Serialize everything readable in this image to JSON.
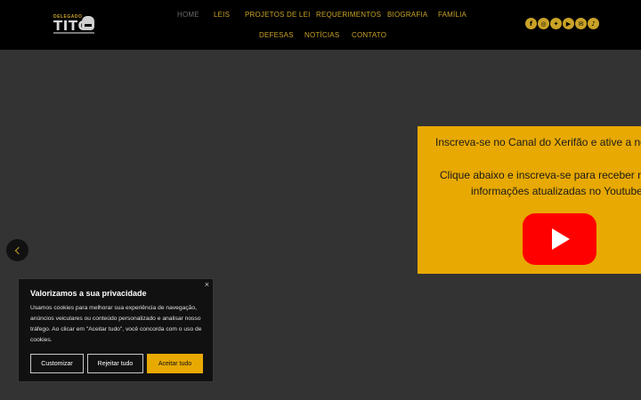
{
  "nav": {
    "items": [
      {
        "label": "HOME",
        "active": true
      },
      {
        "label": "LEIS"
      },
      {
        "label": "PROJETOS DE LEI"
      },
      {
        "label": "REQUERIMENTOS"
      },
      {
        "label": "BIOGRAFIA"
      },
      {
        "label": "FAMÍLIA"
      },
      {
        "label": "DEFESAS"
      },
      {
        "label": "NOTÍCIAS"
      },
      {
        "label": "CONTATO"
      }
    ]
  },
  "logo": {
    "top_text": "DELEGADO",
    "main_text": "TITO"
  },
  "socials": {
    "icons": [
      "facebook-icon",
      "instagram-icon",
      "twitter-icon",
      "youtube-icon",
      "email-icon",
      "tiktok-icon"
    ]
  },
  "promo": {
    "line1": "Inscreva-se no Canal do Xerifão e ative a no",
    "line2": "Clique abaixo e inscreva-se para receber no",
    "line3": "informações atualizadas no Youtube"
  },
  "cookie": {
    "close": "×",
    "title": "Valorizamos a sua privacidade",
    "text": "Usamos cookies para melhorar sua experiência de navegação, anúncios veiculares ou conteúdo personalizado e analisar nosso tráfego. Ao clicar em \"Aceitar tudo\", você concorda com o uso de cookies.",
    "customize": "Customizar",
    "reject": "Rejeitar tudo",
    "accept": "Aceitar tudo"
  },
  "colors": {
    "accent": "#e8a903",
    "header_bg": "#000000",
    "page_bg": "#333333",
    "youtube_red": "#ff0000"
  }
}
